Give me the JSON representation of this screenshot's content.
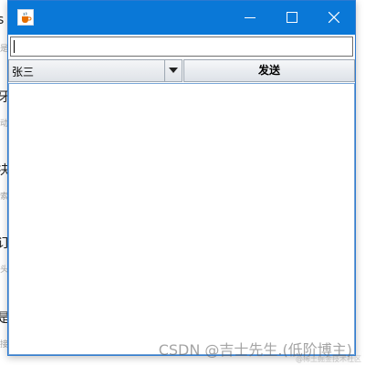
{
  "background": {
    "chars": [
      "s",
      "牙",
      "决",
      "订",
      "是"
    ],
    "subtexts": [
      "是",
      "动",
      "索",
      "头",
      "接"
    ]
  },
  "window": {
    "title": "",
    "titlebar_color": "#0a78d7",
    "app_icon": "java-cup-icon",
    "controls": [
      "minimize-icon",
      "maximize-icon",
      "close-icon"
    ]
  },
  "input": {
    "value": "",
    "placeholder": ""
  },
  "combo": {
    "selected": "张三"
  },
  "send_button": {
    "label": "发送"
  },
  "watermark": {
    "text": "CSDN @吉士先生.(低阶博主)",
    "sub": "@稀土掘金技术社区"
  }
}
